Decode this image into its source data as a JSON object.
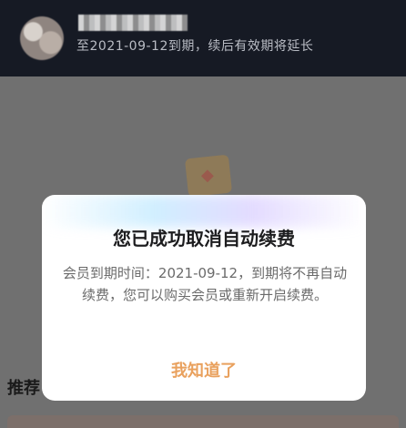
{
  "header": {
    "status_text": "至2021-09-12到期，续后有效期将延长"
  },
  "background": {
    "section_label": "推荐"
  },
  "dialog": {
    "title": "您已成功取消自动续费",
    "message": "会员到期时间：2021-09-12，到期将不再自动续费，您可以购买会员或重新开启续费。",
    "confirm_button": "我知道了"
  },
  "colors": {
    "accent": "#e9a15e",
    "header_bg": "#161a24",
    "overlay_bg": "#707070"
  }
}
